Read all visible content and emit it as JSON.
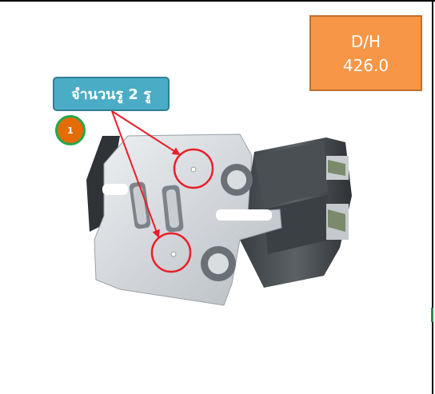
{
  "dh_box": {
    "line1": "D/H",
    "line2": "426.0"
  },
  "callout": {
    "label": "จำนวนรู 2 รู"
  },
  "badge": {
    "number": "1"
  },
  "colors": {
    "dh_box": "#f79646",
    "callout": "#4bacc6",
    "badge_fill": "#e36c09",
    "badge_ring": "#22a84a",
    "arrow": "#e8202a"
  },
  "icons": {
    "part": "metal-bracket-photo"
  }
}
